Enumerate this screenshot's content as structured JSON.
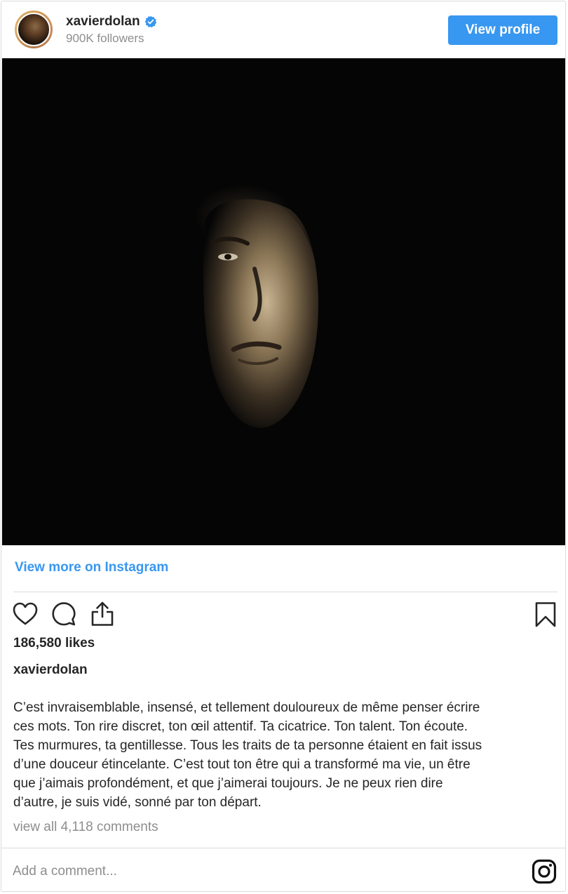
{
  "header": {
    "username": "xavierdolan",
    "followers": "900K followers",
    "view_profile_label": "View profile",
    "verified_color": "#3897f0"
  },
  "post": {
    "image_icon": "portrait-photo",
    "view_more_label": "View more on Instagram",
    "likes": "186,580 likes",
    "caption_user": "xavierdolan",
    "caption_lines": [
      "C’est invraisemblable, insensé, et tellement douloureux de même penser écrire",
      "ces mots. Ton rire discret, ton œil attentif. Ta cicatrice. Ton talent. Ton écoute.",
      "Tes murmures, ta gentillesse. Tous les traits de ta personne étaient en fait issus",
      "d’une douceur étincelante. C’est tout ton être qui a transformé ma vie, un être",
      "que j’aimais profondément, et que j’aimerai toujours. Je ne peux rien dire",
      "d’autre, je suis vidé, sonné par ton départ."
    ],
    "view_all_comments": "view all 4,118 comments"
  },
  "actions": {
    "icons": [
      "heart-icon",
      "comment-icon",
      "share-icon",
      "bookmark-icon"
    ]
  },
  "comment": {
    "placeholder": "Add a comment..."
  },
  "colors": {
    "accent": "#3897f0",
    "text": "#262626",
    "muted": "#8e8e8e",
    "border": "#dbdbdb"
  }
}
